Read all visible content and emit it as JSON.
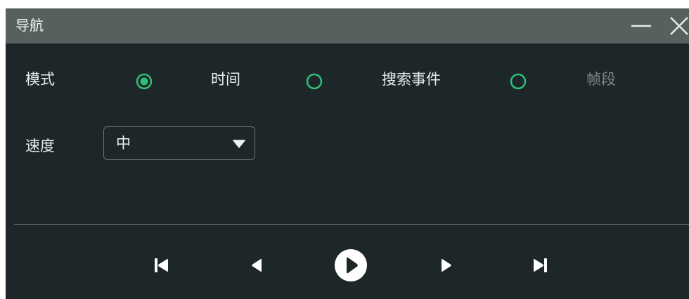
{
  "window": {
    "title": "导航"
  },
  "mode": {
    "label": "模式",
    "options": [
      {
        "label": "时间",
        "selected": true,
        "enabled": true
      },
      {
        "label": "搜索事件",
        "selected": false,
        "enabled": true
      },
      {
        "label": "帧段",
        "selected": false,
        "enabled": false
      }
    ]
  },
  "speed": {
    "label": "速度",
    "value": "中"
  },
  "controls": [
    {
      "icon": "skip-to-start-icon"
    },
    {
      "icon": "step-back-icon"
    },
    {
      "icon": "play-icon"
    },
    {
      "icon": "step-forward-icon"
    },
    {
      "icon": "skip-to-end-icon"
    }
  ],
  "colors": {
    "background": "#1d2628",
    "titlebar": "#57605f",
    "accent": "#2fbf79",
    "text": "#e8ecec",
    "disabled_text": "#7f8788"
  }
}
